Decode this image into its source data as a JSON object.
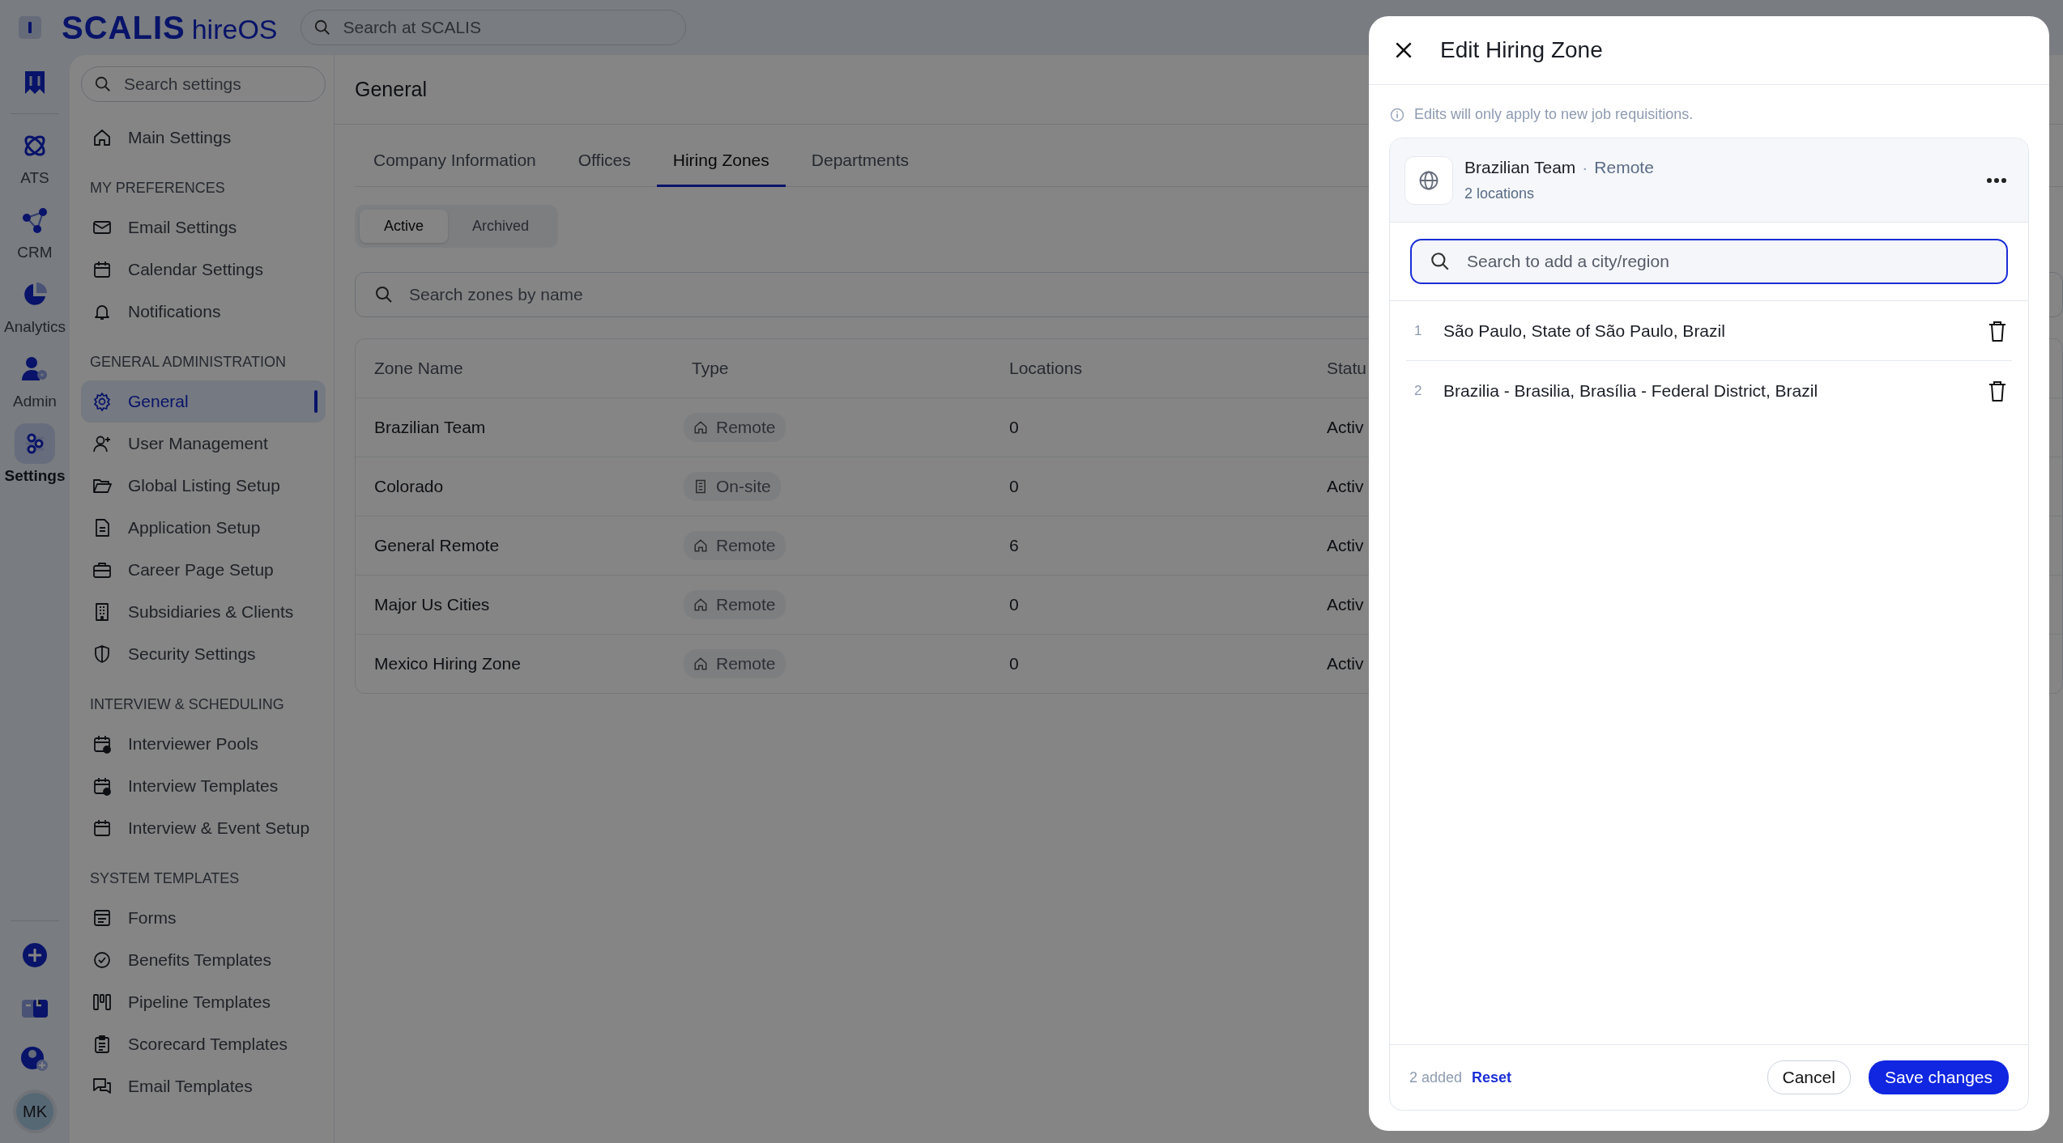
{
  "top_bar": {
    "logo_brand": "SCALIS",
    "logo_product": "hireOS",
    "search_placeholder": "Search at SCALIS"
  },
  "rail": {
    "items": [
      {
        "label": "ATS",
        "selected": false
      },
      {
        "label": "CRM",
        "selected": false
      },
      {
        "label": "Analytics",
        "selected": false
      },
      {
        "label": "Admin",
        "selected": false
      },
      {
        "label": "Settings",
        "selected": true
      }
    ],
    "avatar": "MK"
  },
  "settings_nav": {
    "search_placeholder": "Search settings",
    "sections": [
      {
        "items": [
          {
            "label": "Main Settings",
            "selected": false
          }
        ]
      },
      {
        "heading": "MY PREFERENCES",
        "items": [
          {
            "label": "Email Settings",
            "selected": false
          },
          {
            "label": "Calendar Settings",
            "selected": false
          },
          {
            "label": "Notifications",
            "selected": false
          }
        ]
      },
      {
        "heading": "GENERAL ADMINISTRATION",
        "items": [
          {
            "label": "General",
            "selected": true
          },
          {
            "label": "User Management",
            "selected": false
          },
          {
            "label": "Global Listing Setup",
            "selected": false
          },
          {
            "label": "Application Setup",
            "selected": false
          },
          {
            "label": "Career Page Setup",
            "selected": false
          },
          {
            "label": "Subsidiaries & Clients",
            "selected": false
          },
          {
            "label": "Security Settings",
            "selected": false
          }
        ]
      },
      {
        "heading": "INTERVIEW & SCHEDULING",
        "items": [
          {
            "label": "Interviewer Pools",
            "selected": false
          },
          {
            "label": "Interview Templates",
            "selected": false
          },
          {
            "label": "Interview & Event Setup",
            "selected": false
          }
        ]
      },
      {
        "heading": "SYSTEM TEMPLATES",
        "items": [
          {
            "label": "Forms",
            "selected": false
          },
          {
            "label": "Benefits Templates",
            "selected": false
          },
          {
            "label": "Pipeline Templates",
            "selected": false
          },
          {
            "label": "Scorecard Templates",
            "selected": false
          },
          {
            "label": "Email Templates",
            "selected": false
          }
        ]
      }
    ]
  },
  "main": {
    "title": "General",
    "tabs": [
      {
        "label": "Company Information",
        "selected": false
      },
      {
        "label": "Offices",
        "selected": false
      },
      {
        "label": "Hiring Zones",
        "selected": true
      },
      {
        "label": "Departments",
        "selected": false
      }
    ],
    "filters": [
      {
        "label": "Active",
        "selected": true
      },
      {
        "label": "Archived",
        "selected": false
      }
    ],
    "search_placeholder": "Search zones by name",
    "table": {
      "columns": [
        "Zone Name",
        "Type",
        "Locations",
        "Statu"
      ],
      "rows": [
        {
          "zone": "Brazilian Team",
          "type": {
            "label": "Remote",
            "kind": "remote"
          },
          "locations": "0",
          "status": "Activ"
        },
        {
          "zone": "Colorado",
          "type": {
            "label": "On-site",
            "kind": "onsite"
          },
          "locations": "0",
          "status": "Activ"
        },
        {
          "zone": "General Remote",
          "type": {
            "label": "Remote",
            "kind": "remote"
          },
          "locations": "6",
          "status": "Activ"
        },
        {
          "zone": "Major Us Cities",
          "type": {
            "label": "Remote",
            "kind": "remote"
          },
          "locations": "0",
          "status": "Activ"
        },
        {
          "zone": "Mexico Hiring Zone",
          "type": {
            "label": "Remote",
            "kind": "remote"
          },
          "locations": "0",
          "status": "Activ"
        }
      ]
    }
  },
  "dialog": {
    "title": "Edit Hiring Zone",
    "note": "Edits will only apply to new job requisitions.",
    "zone": {
      "name": "Brazilian Team",
      "separator": "·",
      "type": "Remote",
      "count": "2 locations"
    },
    "search_placeholder": "Search to add a city/region",
    "locations": [
      {
        "number": "1",
        "name": "São Paulo, State of São Paulo, Brazil"
      },
      {
        "number": "2",
        "name": "Brazilia - Brasilia, Brasília - Federal District, Brazil"
      }
    ],
    "footer": {
      "summary": "2 added",
      "reset": "Reset",
      "cancel": "Cancel",
      "save": "Save changes"
    }
  }
}
